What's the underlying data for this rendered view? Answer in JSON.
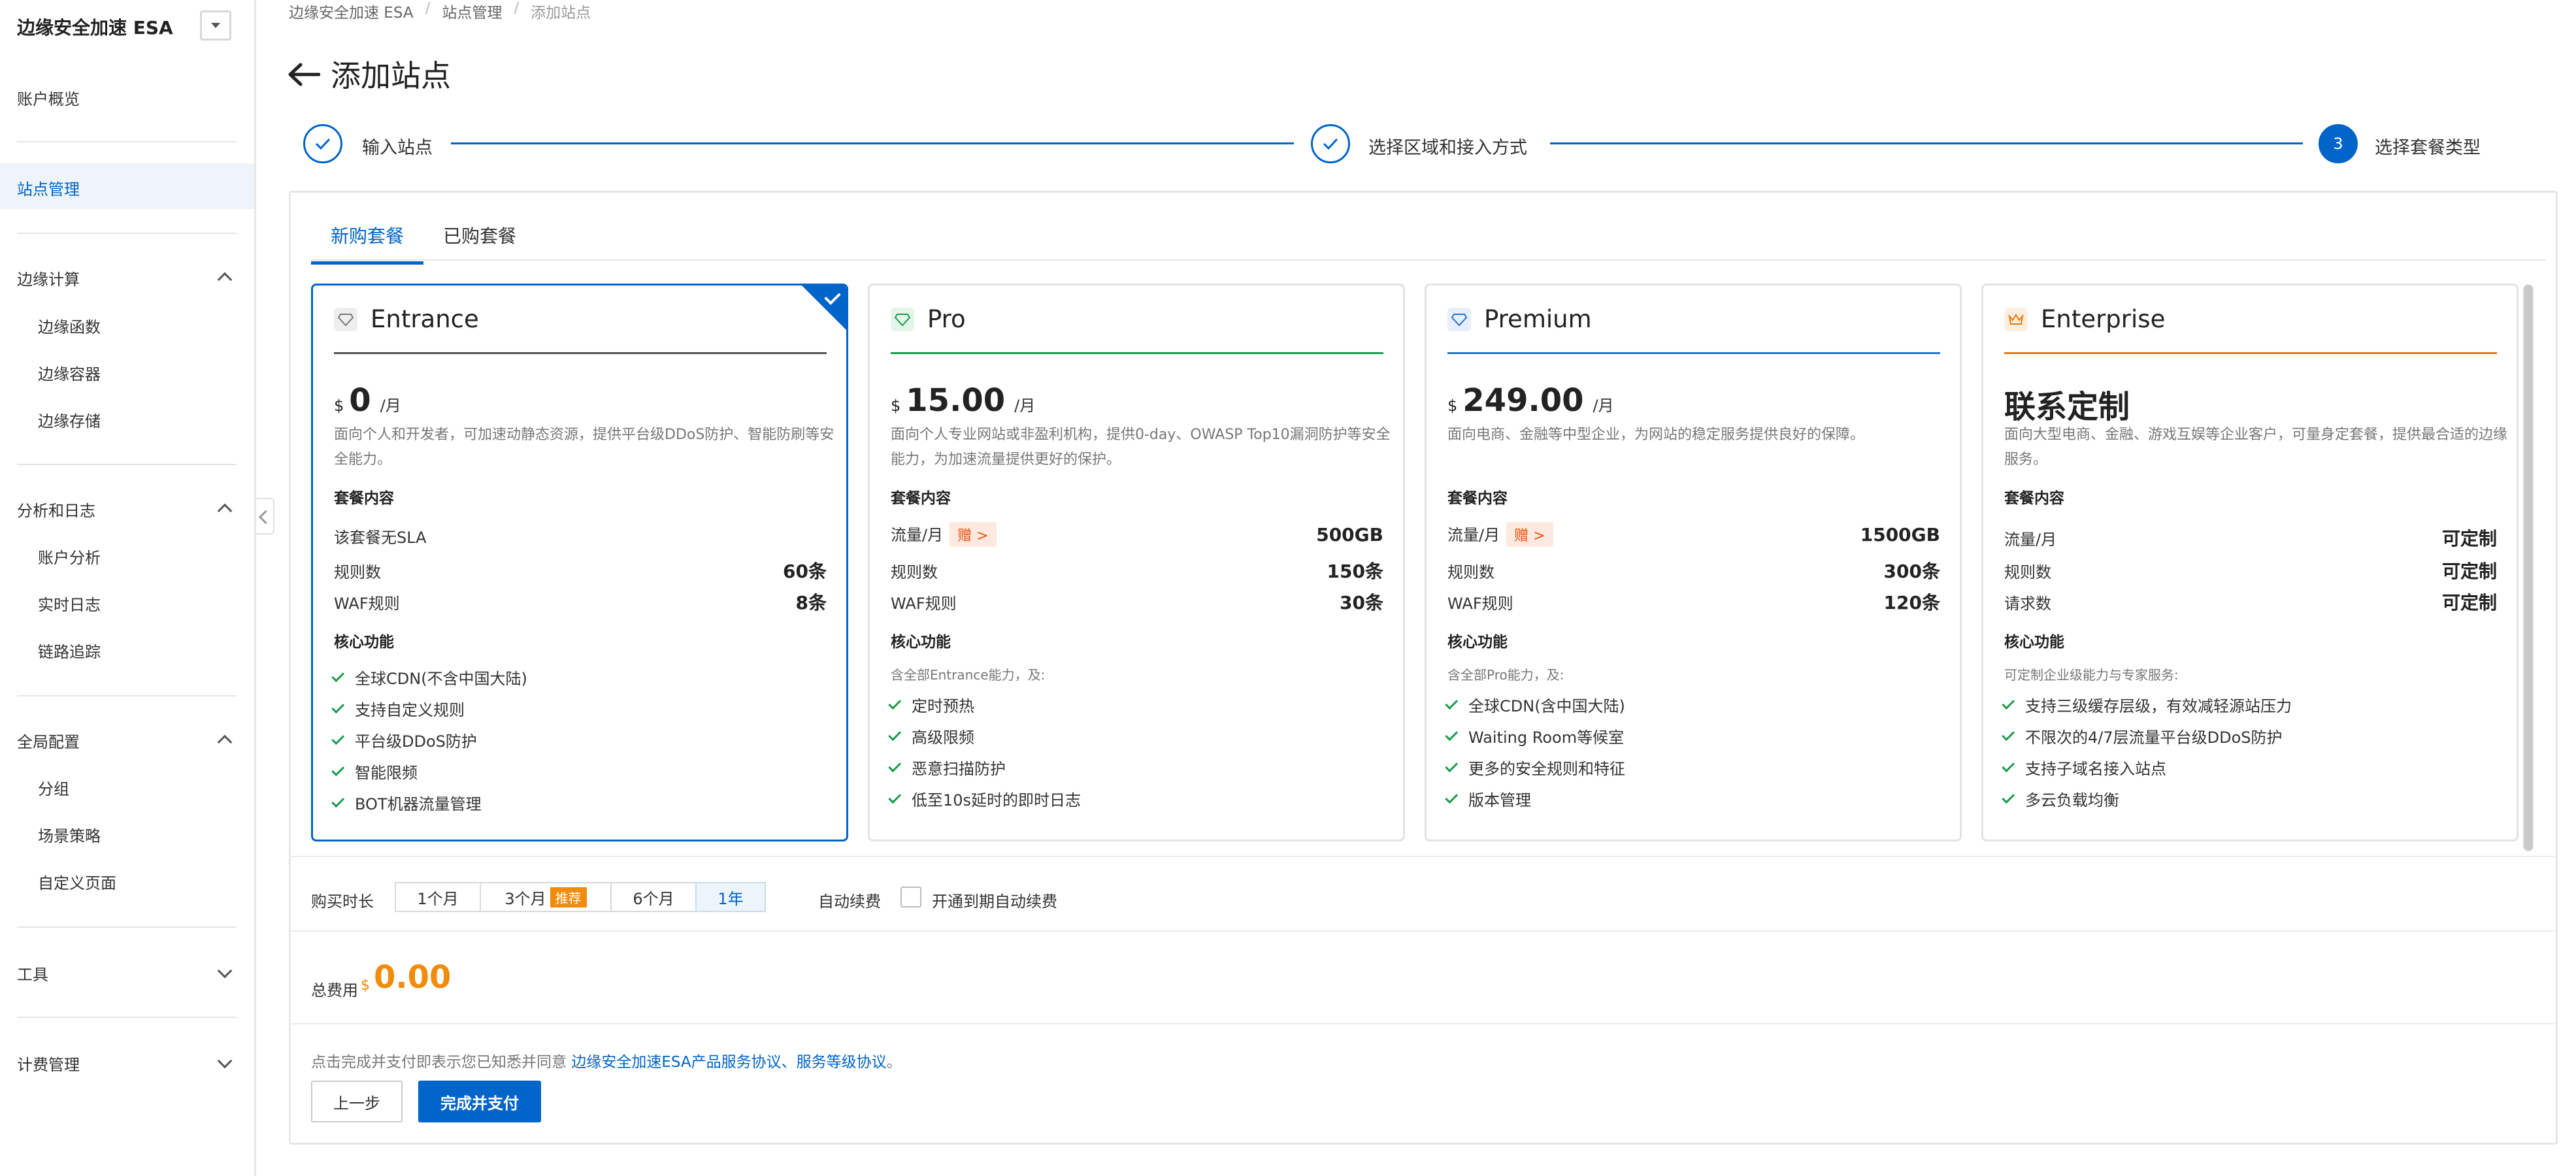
{
  "sidebar": {
    "title": "边缘安全加速 ESA",
    "overview": "账户概览",
    "site_mgmt": "站点管理",
    "groups": [
      {
        "label": "边缘计算",
        "items": [
          "边缘函数",
          "边缘容器",
          "边缘存储"
        ]
      },
      {
        "label": "分析和日志",
        "items": [
          "账户分析",
          "实时日志",
          "链路追踪"
        ]
      },
      {
        "label": "全局配置",
        "items": [
          "分组",
          "场景策略",
          "自定义页面"
        ]
      },
      {
        "label": "工具",
        "items": []
      },
      {
        "label": "计费管理",
        "items": []
      }
    ]
  },
  "breadcrumb": [
    "边缘安全加速 ESA",
    "站点管理",
    "添加站点"
  ],
  "page_title": "添加站点",
  "steps": [
    {
      "label": "输入站点",
      "state": "done"
    },
    {
      "label": "选择区域和接入方式",
      "state": "done"
    },
    {
      "label": "选择套餐类型",
      "state": "current",
      "number": "3"
    }
  ],
  "tabs": [
    "新购套餐",
    "已购套餐"
  ],
  "plans": [
    {
      "name": "Entrance",
      "currency": "$",
      "price": "0",
      "per": "/月",
      "desc": "面向个人和开发者，可加速动静态资源，提供平台级DDoS防护、智能防刷等安全能力。",
      "content_title": "套餐内容",
      "rows": [
        {
          "k": "该套餐无SLA",
          "v": ""
        },
        {
          "k": "规则数",
          "v": "60条"
        },
        {
          "k": "WAF规则",
          "v": "8条"
        }
      ],
      "features_title": "核心功能",
      "features_note": "",
      "features": [
        "全球CDN(不含中国大陆)",
        "支持自定义规则",
        "平台级DDoS防护",
        "智能限频",
        "BOT机器流量管理"
      ],
      "selected": true,
      "accent": "#555555"
    },
    {
      "name": "Pro",
      "currency": "$",
      "price": "15.00",
      "per": "/月",
      "desc": "面向个人专业网站或非盈利机构，提供0-day、OWASP Top10漏洞防护等安全能力，为加速流量提供更好的保护。",
      "content_title": "套餐内容",
      "rows": [
        {
          "k": "流量/月",
          "gift": "赠 >",
          "v": "500GB"
        },
        {
          "k": "规则数",
          "v": "150条"
        },
        {
          "k": "WAF规则",
          "v": "30条"
        }
      ],
      "features_title": "核心功能",
      "features_note": "含全部Entrance能力，及:",
      "features": [
        "定时预热",
        "高级限频",
        "恶意扫描防护",
        "低至10s延时的即时日志"
      ],
      "selected": false,
      "accent": "#1a9b4b"
    },
    {
      "name": "Premium",
      "currency": "$",
      "price": "249.00",
      "per": "/月",
      "desc": "面向电商、金融等中型企业，为网站的稳定服务提供良好的保障。",
      "content_title": "套餐内容",
      "rows": [
        {
          "k": "流量/月",
          "gift": "赠 >",
          "v": "1500GB"
        },
        {
          "k": "规则数",
          "v": "300条"
        },
        {
          "k": "WAF规则",
          "v": "120条"
        }
      ],
      "features_title": "核心功能",
      "features_note": "含全部Pro能力，及:",
      "features": [
        "全球CDN(含中国大陆)",
        "Waiting Room等候室",
        "更多的安全规则和特征",
        "版本管理"
      ],
      "selected": false,
      "accent": "#2a6fd6"
    },
    {
      "name": "Enterprise",
      "price_text": "联系定制",
      "desc": "面向大型电商、金融、游戏互娱等企业客户，可量身定套餐，提供最合适的边缘服务。",
      "content_title": "套餐内容",
      "rows": [
        {
          "k": "流量/月",
          "v": "可定制"
        },
        {
          "k": "规则数",
          "v": "可定制"
        },
        {
          "k": "请求数",
          "v": "可定制"
        }
      ],
      "features_title": "核心功能",
      "features_note": "可定制企业级能力与专家服务:",
      "features": [
        "支持三级缓存层级，有效减轻源站压力",
        "不限次的4/7层流量平台级DDoS防护",
        "支持子域名接入站点",
        "多云负载均衡"
      ],
      "selected": false,
      "accent": "#e8780e"
    }
  ],
  "duration": {
    "label": "购买时长",
    "options": [
      "1个月",
      "3个月",
      "6个月",
      "1年"
    ],
    "recommend_tag": "推荐",
    "selected": "1年"
  },
  "auto_renew": {
    "label": "自动续费",
    "option": "开通到期自动续费",
    "checked": false
  },
  "total": {
    "label": "总费用",
    "currency": "$",
    "value": "0.00"
  },
  "agreement": {
    "text": "点击完成并支付即表示您已知悉并同意",
    "link1": "边缘安全加速ESA产品服务协议",
    "sep": "、",
    "link2": "服务等级协议",
    "end": "。"
  },
  "buttons": {
    "prev": "上一步",
    "pay": "完成并支付"
  }
}
